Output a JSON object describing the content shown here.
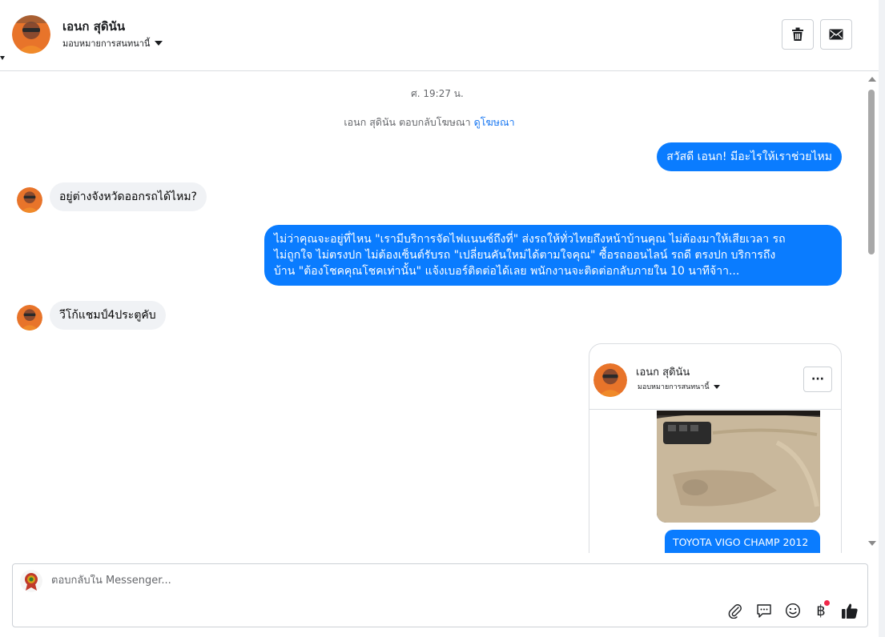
{
  "header": {
    "contact_name": "เอนก สุดินัน",
    "assign_label": "มอบหมายการสนทนานี้"
  },
  "conversation": {
    "timestamp": "ศ. 19:27 น.",
    "ad_reply_text": "เอนก สุดินัน ตอบกลับโฆษณา",
    "ad_link": "ดูโฆษณา",
    "messages": [
      {
        "from": "page",
        "text": "สวัสดี เอนก! มีอะไรให้เราช่วยไหม"
      },
      {
        "from": "customer",
        "text": "อยู่ต่างจังหวัดออกรถได้ไหม?"
      },
      {
        "from": "page",
        "lines": [
          "ไม่ว่าคุณจะอยู่ที่ไหน \"เรามีบริการจัดไฟแนนซ์ถึงที่\"  ส่งรถให้ทั่วไทยถึงหน้าบ้านคุณ ไม่ต้องมาให้เสียเวลา รถ",
          "ไม่ถูกใจ ไม่ตรงปก ไม่ต้องเซ็นต์รับรถ \"เปลี่ยนคันใหม่ได้ตามใจคุณ\" ซื้อรถออนไลน์ รถดี ตรงปก บริการถึง",
          "บ้าน \"ต้องโชคคุณโชคเท่านั้น\" แจ้งเบอร์ติดต่อได้เลย พนักงานจะติดต่อกลับภายใน 10 นาทีจ้าา..."
        ]
      },
      {
        "from": "customer",
        "text": "วีโก้แชมป์4ประตูคับ"
      }
    ],
    "card": {
      "name": "เอนก สุดินัน",
      "assign_label": "มอบหมายการสนทนานี้",
      "more_label": "···",
      "photo_caption": "TOYOTA VIGO CHAMP 2012"
    }
  },
  "composer": {
    "placeholder": "ตอบกลับใน Messenger...",
    "currency_symbol": "฿",
    "tools": [
      "paperclip-icon",
      "speech-bubble-icon",
      "smiley-icon",
      "baht-icon",
      "thumbs-up-icon"
    ]
  },
  "colors": {
    "outgoing_bubble": "#0a7cff",
    "incoming_bubble": "#f0f2f5",
    "link": "#1877f2",
    "notification_dot": "#f02849"
  }
}
